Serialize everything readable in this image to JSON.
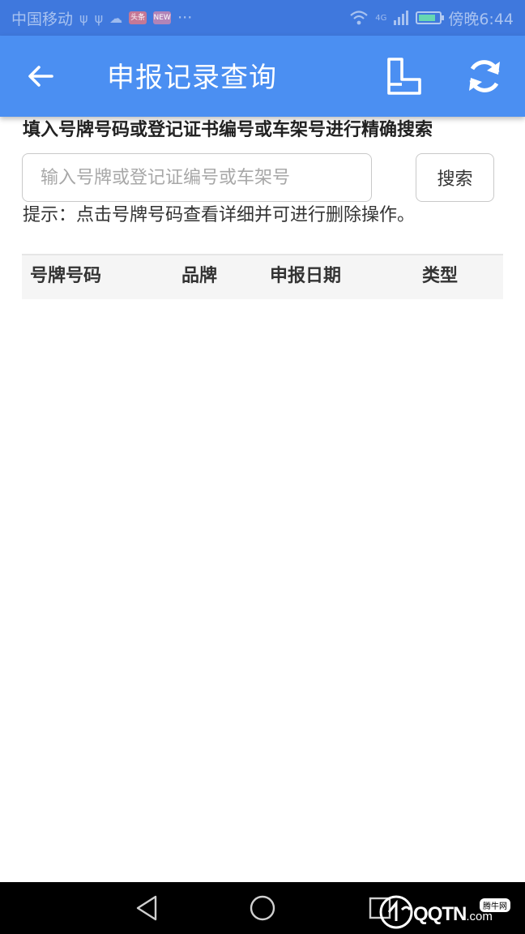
{
  "status_bar": {
    "carrier": "中国移动",
    "network": "4G",
    "time": "傍晚6:44",
    "badge1": "头条",
    "badge2": "NEW",
    "overflow": "···"
  },
  "app_bar": {
    "title": "申报记录查询",
    "icons": [
      "back-arrow-icon",
      "bind-device-icon",
      "refresh-icon"
    ]
  },
  "search": {
    "instruction": "填入号牌号码或登记证书编号或车架号进行精确搜索",
    "placeholder": "输入号牌或登记证编号或车架号",
    "value": "",
    "button_label": "搜索",
    "hint": "提示：点击号牌号码查看详细并可进行删除操作。"
  },
  "table": {
    "columns": [
      "号牌号码",
      "品牌",
      "申报日期",
      "类型"
    ],
    "rows": []
  },
  "watermark": {
    "brand": "QQTN",
    "suffix": ".com",
    "badge": "腾牛网"
  },
  "colors": {
    "status_bar_bg": "#3f78dd",
    "app_bar_bg": "#4b8ff2",
    "header_row_bg": "#f5f5f5",
    "nav_bar_bg": "#000000"
  }
}
